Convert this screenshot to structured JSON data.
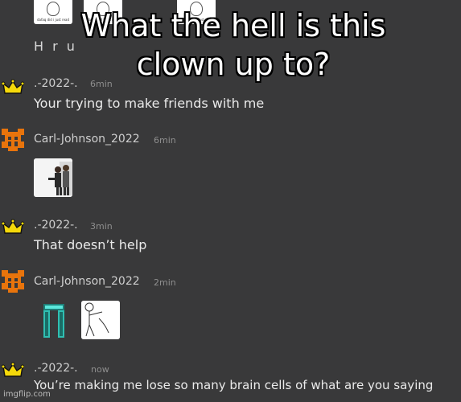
{
  "overlay_caption": "What the hell is this clown up to?",
  "top_thumbs": [
    {
      "caption": "dafaq did i just read"
    },
    {
      "caption": "dafaq did i just read"
    },
    {
      "caption": "dafaq did i just read"
    }
  ],
  "previous_message": "H r u",
  "messages": [
    {
      "username": ".-2022-.",
      "time": "6min",
      "text": "Your trying to make friends with me",
      "avatar_icon": "crown-icon"
    },
    {
      "username": "Carl-Johnson_2022",
      "time": "6min",
      "text": "",
      "avatar_icon": "pixel-skull-icon",
      "attachment": "image"
    },
    {
      "username": ".-2022-.",
      "time": "3min",
      "text": "That doesn’t help",
      "avatar_icon": "crown-icon"
    },
    {
      "username": "Carl-Johnson_2022",
      "time": "2min",
      "text": "",
      "avatar_icon": "pixel-skull-icon",
      "attachment": "images"
    },
    {
      "username": ".-2022-.",
      "time": "now",
      "text": "You’re making me lose so many brain cells of what are you saying",
      "avatar_icon": "crown-icon"
    }
  ],
  "watermark": "imgflip.com",
  "colors": {
    "background": "#39393a",
    "username": "#cfcfcf",
    "time": "#8e8e8e",
    "crown": "#f5d90a",
    "pixel_skull": "#e8740c"
  }
}
